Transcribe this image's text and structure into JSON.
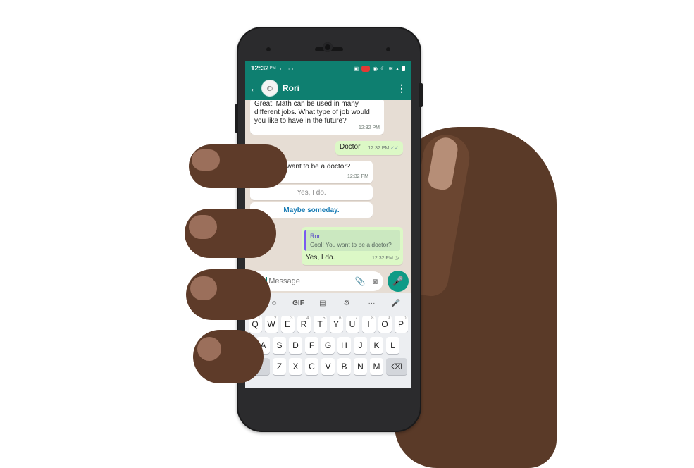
{
  "status": {
    "time": "12:32",
    "ampm": "PM"
  },
  "header": {
    "contact": "Rori"
  },
  "chat": {
    "messages": [
      {
        "dir": "in",
        "text_lines": [
          "Great! Math can be used in many",
          "different jobs. What type of job would",
          "you like to have in the future?"
        ],
        "time": "12:32 PM"
      },
      {
        "dir": "out",
        "text": "Doctor",
        "time": "12:32 PM"
      },
      {
        "dir": "in",
        "text": "Cool!  You want to be a doctor?",
        "time": "12:32 PM"
      },
      {
        "dir": "out",
        "quote_name": "Rori",
        "quote_text": "Cool!  You want to be a doctor?",
        "text": "Yes, I do.",
        "time": "12:32 PM"
      }
    ],
    "quick_replies": [
      {
        "label": "Yes, I do.",
        "color": "#8a8a8a"
      },
      {
        "label": "Maybe someday.",
        "color": "#1a7db5"
      }
    ]
  },
  "input": {
    "placeholder": "Message"
  },
  "keyboard": {
    "toolbar": [
      "<",
      "☺",
      "GIF",
      "▤",
      "⚙",
      "···",
      "🎤"
    ],
    "rows": [
      [
        {
          "k": "Q",
          "n": "1"
        },
        {
          "k": "W",
          "n": "2"
        },
        {
          "k": "E",
          "n": "3"
        },
        {
          "k": "R",
          "n": "4"
        },
        {
          "k": "T",
          "n": "5"
        },
        {
          "k": "Y",
          "n": "6"
        },
        {
          "k": "U",
          "n": "7"
        },
        {
          "k": "I",
          "n": "8"
        },
        {
          "k": "O",
          "n": "9"
        },
        {
          "k": "P",
          "n": "0"
        }
      ],
      [
        {
          "k": "A"
        },
        {
          "k": "S"
        },
        {
          "k": "D"
        },
        {
          "k": "F"
        },
        {
          "k": "G"
        },
        {
          "k": "H"
        },
        {
          "k": "J"
        },
        {
          "k": "K"
        },
        {
          "k": "L"
        }
      ],
      [
        {
          "k": "⬆",
          "mod": true
        },
        {
          "k": "Z"
        },
        {
          "k": "X"
        },
        {
          "k": "C"
        },
        {
          "k": "V"
        },
        {
          "k": "B"
        },
        {
          "k": "N"
        },
        {
          "k": "M"
        },
        {
          "k": "⌫",
          "mod": true
        }
      ]
    ]
  },
  "colors": {
    "brand": "#0e7f70",
    "outgoing": "#dcf8c6",
    "incoming": "#ffffff"
  }
}
